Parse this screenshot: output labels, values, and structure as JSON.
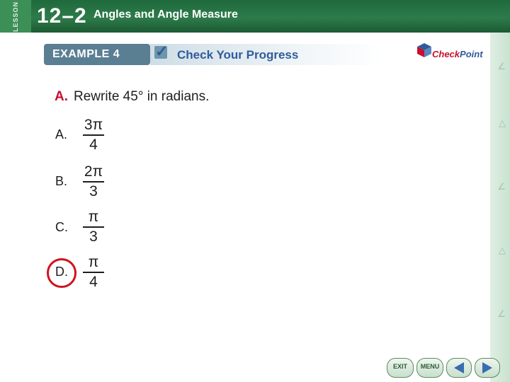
{
  "header": {
    "lesson_label": "LESSON",
    "lesson_number": "12–2",
    "lesson_title": "Angles and Angle Measure"
  },
  "banner": {
    "example_label": "EXAMPLE 4",
    "progress_label": "Check Your Progress"
  },
  "logo": {
    "text_check": "Check",
    "text_point": "Point"
  },
  "question": {
    "part": "A.",
    "text": "Rewrite 45° in radians."
  },
  "choices": [
    {
      "letter": "A.",
      "numerator": "3π",
      "denominator": "4",
      "selected": false
    },
    {
      "letter": "B.",
      "numerator": "2π",
      "denominator": "3",
      "selected": false
    },
    {
      "letter": "C.",
      "numerator": "π",
      "denominator": "3",
      "selected": false
    },
    {
      "letter": "D.",
      "numerator": "π",
      "denominator": "4",
      "selected": true
    }
  ],
  "nav": {
    "exit_label": "EXIT",
    "menu_label": "MENU",
    "prev_icon": "left-arrow-icon",
    "next_icon": "right-arrow-icon"
  },
  "colors": {
    "header_green": "#2d7b4a",
    "banner_blue": "#5a7f93",
    "accent_red": "#c8102e",
    "text_blue": "#2f5b9c"
  }
}
